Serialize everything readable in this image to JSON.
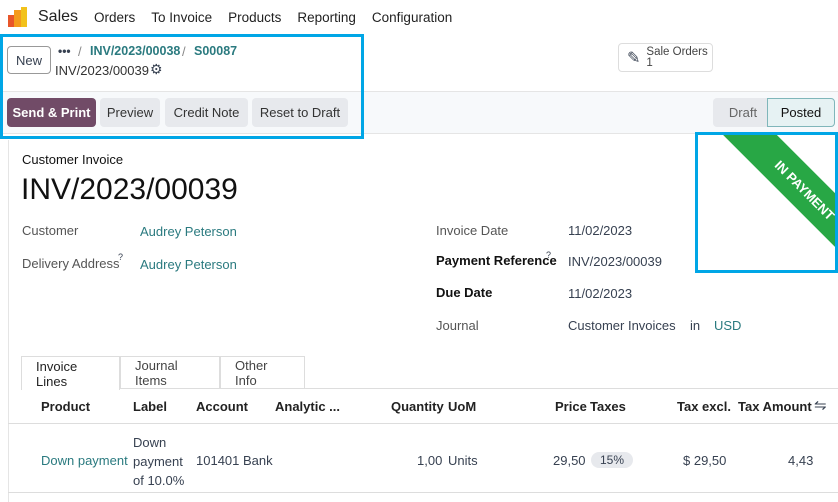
{
  "nav": {
    "app": "Sales",
    "items": [
      "Orders",
      "To Invoice",
      "Products",
      "Reporting",
      "Configuration"
    ]
  },
  "control": {
    "new": "New",
    "more": "•••",
    "breadcrumbs": [
      "INV/2023/00038",
      "S00087"
    ],
    "current": "INV/2023/00039",
    "smart_button": {
      "label": "Sale Orders",
      "count": "1"
    }
  },
  "actions": {
    "send_print": "Send & Print",
    "preview": "Preview",
    "credit_note": "Credit Note",
    "reset": "Reset to Draft"
  },
  "status": {
    "steps": [
      "Draft",
      "Posted"
    ],
    "active": "Posted"
  },
  "ribbon": {
    "text": "IN PAYMENT",
    "color": "#28a745"
  },
  "form": {
    "type": "Customer Invoice",
    "number": "INV/2023/00039",
    "customer_label": "Customer",
    "customer": "Audrey Peterson",
    "delivery_label": "Delivery Address",
    "delivery": "Audrey Peterson",
    "help": "?",
    "invoice_date_label": "Invoice Date",
    "invoice_date": "11/02/2023",
    "payment_ref_label": "Payment Reference",
    "payment_ref": "INV/2023/00039",
    "due_label": "Due Date",
    "due": "11/02/2023",
    "journal_label": "Journal",
    "journal": "Customer Invoices",
    "in": "in",
    "currency": "USD"
  },
  "tabs": [
    "Invoice Lines",
    "Journal Items",
    "Other Info"
  ],
  "table": {
    "headers": [
      "Product",
      "Label",
      "Account",
      "Analytic ...",
      "Quantity",
      "UoM",
      "Price",
      "Taxes",
      "Tax excl.",
      "Tax Amount"
    ],
    "rows": [
      {
        "product": "Down payment",
        "label": [
          "Down",
          "payment",
          "of 10.0%"
        ],
        "account": "101401 Bank",
        "quantity": "1,00",
        "uom": "Units",
        "price": "29,50",
        "taxes": "15%",
        "tax_excl": "$ 29,50",
        "tax_amount": "4,43"
      }
    ]
  },
  "colors": {
    "primary": "#714b67",
    "link": "#2a7a7f",
    "highlight": "#00a6e6"
  }
}
